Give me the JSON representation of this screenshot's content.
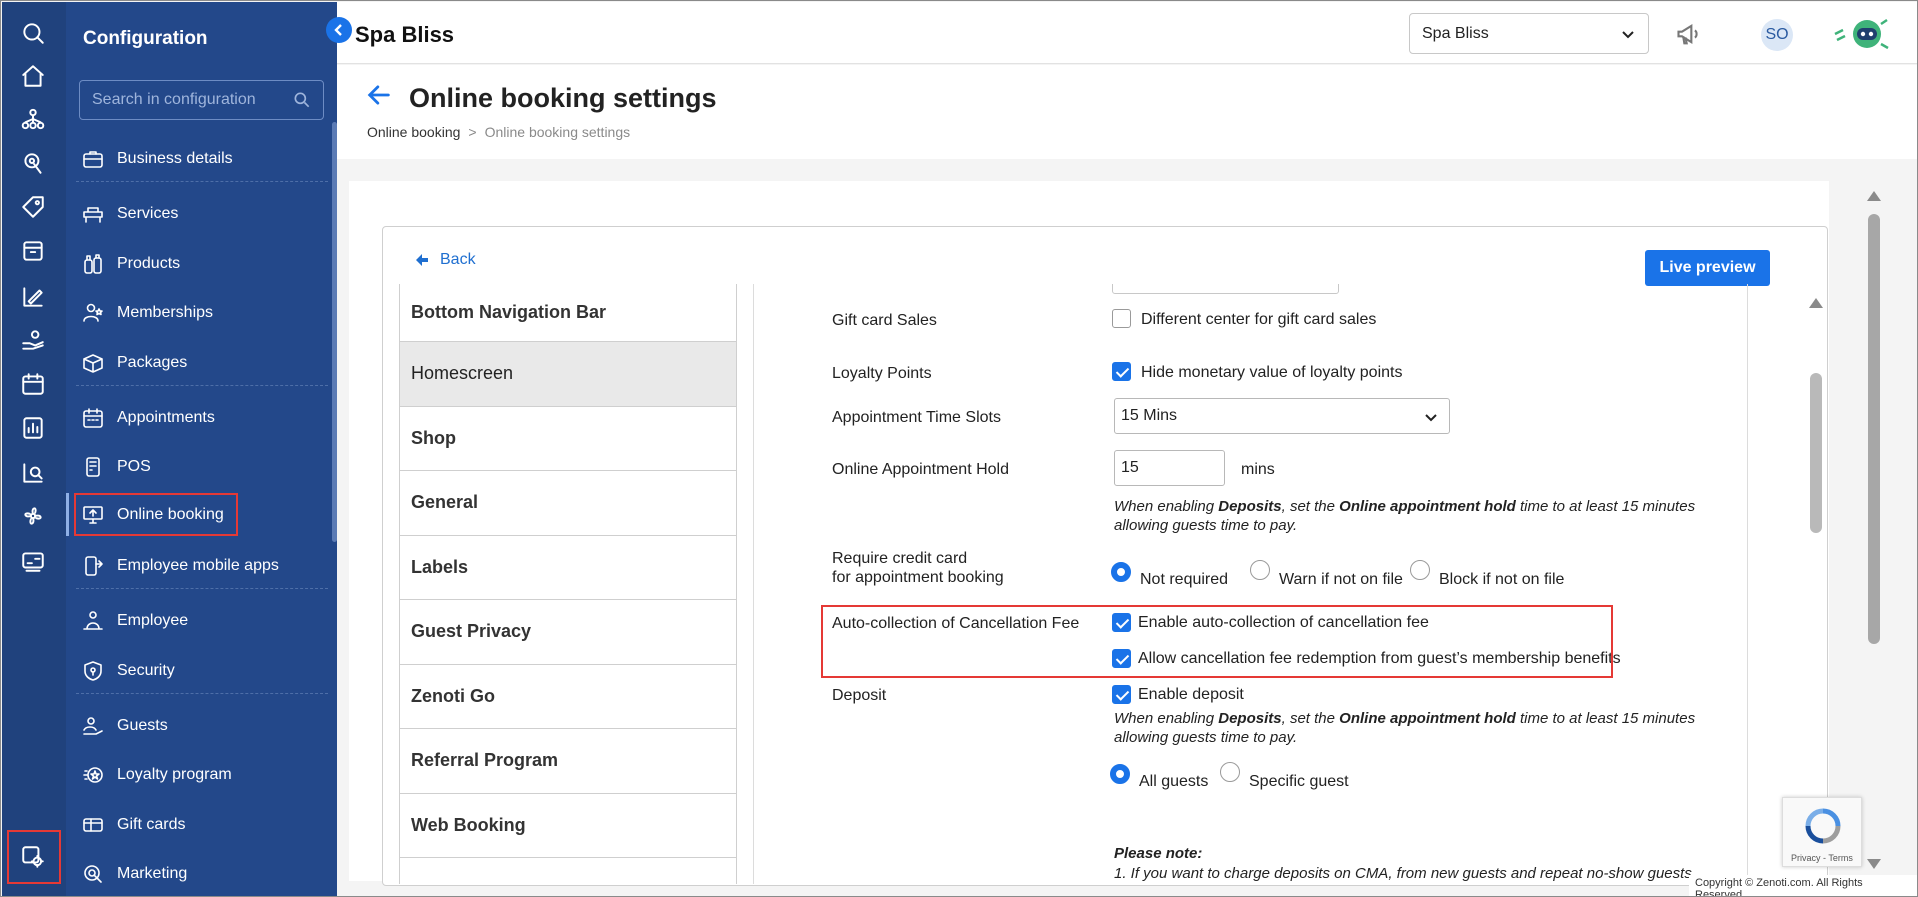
{
  "rail": {
    "icons": [
      "search-icon",
      "home-icon",
      "org-chart-icon",
      "touch-icon",
      "tag-icon",
      "box-icon",
      "pen-ruler-icon",
      "hand-coin-icon",
      "calendar-icon",
      "report-icon",
      "analytics-icon",
      "fan-icon",
      "billing-icon",
      "settings-gear-icon"
    ]
  },
  "config": {
    "title": "Configuration",
    "search_placeholder": "Search in configuration",
    "items": [
      {
        "label": "Business details",
        "icon": "briefcase-icon"
      },
      {
        "label": "Services",
        "icon": "spa-bed-icon"
      },
      {
        "label": "Products",
        "icon": "bottles-icon"
      },
      {
        "label": "Memberships",
        "icon": "member-icon"
      },
      {
        "label": "Packages",
        "icon": "package-icon"
      },
      {
        "label": "Appointments",
        "icon": "calendar-icon"
      },
      {
        "label": "POS",
        "icon": "pos-icon"
      },
      {
        "label": "Online booking",
        "icon": "monitor-icon"
      },
      {
        "label": "Employee mobile apps",
        "icon": "mobile-icon"
      },
      {
        "label": "Employee",
        "icon": "employee-icon"
      },
      {
        "label": "Security",
        "icon": "shield-icon"
      },
      {
        "label": "Guests",
        "icon": "guest-icon"
      },
      {
        "label": "Loyalty program",
        "icon": "loyalty-icon"
      },
      {
        "label": "Gift cards",
        "icon": "gift-card-icon"
      },
      {
        "label": "Marketing",
        "icon": "marketing-icon"
      }
    ]
  },
  "topbar": {
    "brand": "Spa Bliss",
    "center": "Spa Bliss",
    "avatar": "SO"
  },
  "header": {
    "title": "Online booking settings",
    "breadcrumb": [
      "Online booking",
      "Online booking settings"
    ]
  },
  "content": {
    "back_label": "Back",
    "live_preview": "Live preview",
    "nav": [
      "Bottom Navigation Bar",
      "Homescreen",
      "Shop",
      "General",
      "Labels",
      "Guest Privacy",
      "Zenoti Go",
      "Referral Program",
      "Web Booking"
    ],
    "settings": {
      "gift_card_label": "Gift card Sales",
      "gift_card_option": "Different center for gift card sales",
      "gift_card_checked": false,
      "loyalty_label": "Loyalty Points",
      "loyalty_option": "Hide monetary value of loyalty points",
      "loyalty_checked": true,
      "time_slots_label": "Appointment Time Slots",
      "time_slots_value": "15 Mins",
      "hold_label": "Online Appointment Hold",
      "hold_value": "15",
      "hold_unit": "mins",
      "hold_note": {
        "a": "When enabling ",
        "b": "Deposits",
        "c": ", set the ",
        "d": "Online appointment hold",
        "e": " time to at least 15 minutes allowing guests time to pay."
      },
      "credit_label_1": "Require credit card",
      "credit_label_2": "for appointment booking",
      "credit_options": [
        "Not required",
        "Warn if not on file",
        "Block if not on file"
      ],
      "credit_selected": "Not required",
      "cancel_label": "Auto-collection of Cancellation Fee",
      "cancel_option_1": "Enable auto-collection of cancellation fee",
      "cancel_option_2": "Allow cancellation fee redemption from guest’s membership benefits",
      "deposit_label": "Deposit",
      "deposit_option": "Enable deposit",
      "deposit_note": {
        "a": "When enabling ",
        "b": "Deposits",
        "c": ", set the ",
        "d": "Online appointment hold",
        "e": " time to at least 15 minutes allowing guests time to pay."
      },
      "deposit_options": [
        "All guests",
        "Specific guest"
      ],
      "please_note": "Please note:",
      "note_line_1": "1. If you want to charge deposits on CMA, from new guests and repeat no-show guests"
    }
  },
  "recaptcha_terms": "Privacy - Terms",
  "footer": "Copyright © Zenoti.com. All Rights Reserved",
  "colors": {
    "rail": "#20427d",
    "panel": "#23488a",
    "accent": "#1a73e8",
    "highlight": "#e53935"
  }
}
